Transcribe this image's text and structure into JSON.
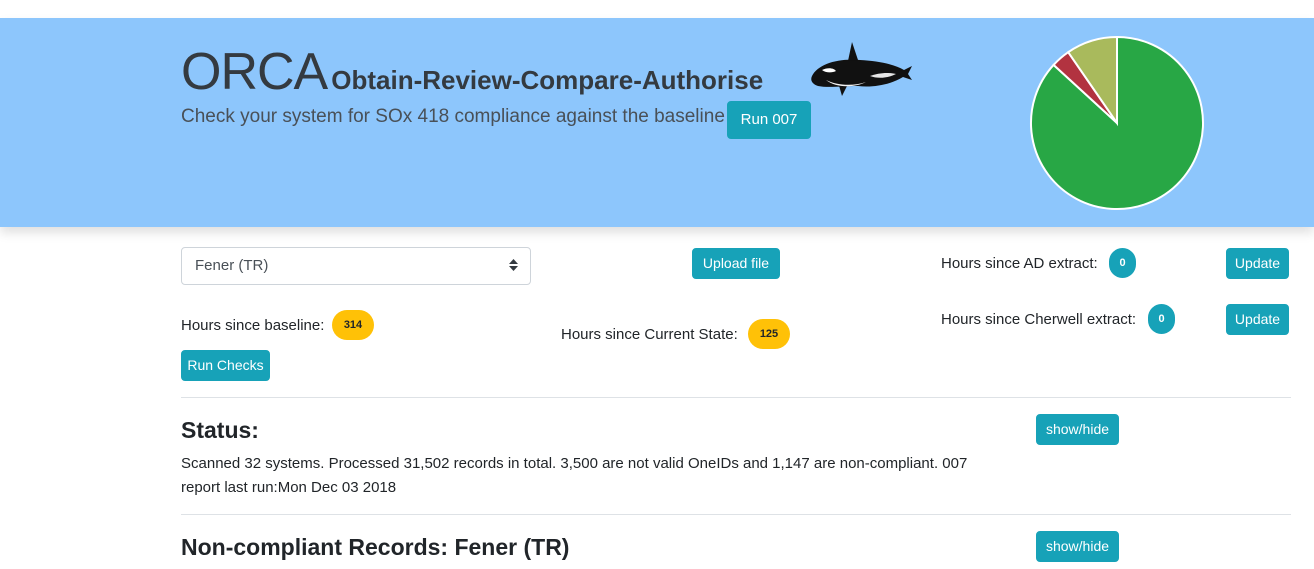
{
  "header": {
    "title": "ORCA",
    "subtitle": "Obtain-Review-Compare-Authorise",
    "tagline": "Check your system for SOx 418 compliance against the baseline",
    "run_button": "Run 007",
    "logo_icon": "orca-whale-icon",
    "bg_color": "#8dc6fc"
  },
  "chart_data": {
    "type": "pie",
    "title": "",
    "slices": [
      {
        "label": "",
        "value": 86.8,
        "color": "#28a745"
      },
      {
        "label": "",
        "value": 3.6,
        "color": "#b23340"
      },
      {
        "label": "",
        "value": 9.6,
        "color": "#a9ba5c"
      }
    ]
  },
  "controls": {
    "system_select": {
      "value": "Fener (TR)",
      "icon": "select-caret-icon"
    },
    "upload_button": "Upload file",
    "baseline": {
      "label": "Hours since baseline:",
      "value": "314"
    },
    "run_checks_button": "Run Checks",
    "current_state": {
      "label": "Hours since Current State:",
      "value": "125"
    },
    "ad_extract": {
      "label": "Hours since AD extract:",
      "value": "0",
      "update_label": "Update"
    },
    "cherwell_extract": {
      "label": "Hours since Cherwell extract:",
      "value": "0",
      "update_label": "Update"
    }
  },
  "status": {
    "heading": "Status:",
    "toggle_label": "show/hide",
    "line1": "Scanned 32 systems. Processed 31,502 records in total. 3,500 are not valid OneIDs and 1,147 are non-compliant. 007",
    "line2": "report last run:Mon Dec 03 2018"
  },
  "noncompliant": {
    "heading": "Non-compliant Records: Fener (TR)",
    "toggle_label": "show/hide"
  }
}
